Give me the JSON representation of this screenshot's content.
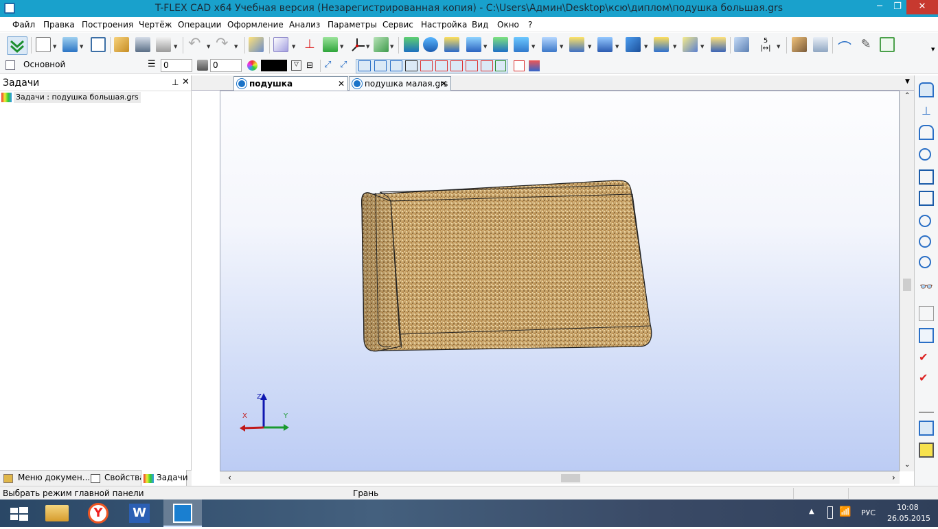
{
  "window": {
    "title": "T-FLEX CAD x64 Учебная версия (Незарегистрированная копия) - C:\\Users\\Админ\\Desktop\\ксю\\диплом\\подушка большая.grs"
  },
  "menu": [
    "Файл",
    "Правка",
    "Построения",
    "Чертёж",
    "Операции",
    "Оформление",
    "Анализ",
    "Параметры",
    "Сервис",
    "Настройка",
    "Вид",
    "Окно",
    "?"
  ],
  "toolbar2": {
    "layer_label": "Основной",
    "line_width_value": "0",
    "priority_value": "0"
  },
  "left_panel": {
    "title": "Задачи",
    "tree_item": "Задачи : подушка большая.grs",
    "bottom_tabs": [
      "Меню докумен...",
      "Свойства",
      "Задачи"
    ]
  },
  "doc_tabs": [
    "подушка большая.grs",
    "подушка малая.grs"
  ],
  "axes": {
    "x": "X",
    "y": "Y",
    "z": "Z"
  },
  "status": {
    "left": "Выбрать режим главной панели",
    "center": "Грань"
  },
  "taskbar": {
    "lang": "РУС",
    "time": "10:08",
    "date": "26.05.2015"
  },
  "colors": {
    "title_bar": "#19a1cc",
    "pillow": "#c9a56b",
    "accent": "#0c6aa8"
  },
  "icons": {
    "toolbar": [
      "check-icon",
      "new-document-icon",
      "new-3d-icon",
      "window-icon",
      "open-icon",
      "save-icon",
      "print-icon",
      "undo-icon",
      "redo-icon",
      "pen-icon",
      "sketch-icon",
      "line-icon",
      "profile-icon",
      "axes-icon",
      "workplane-icon",
      "extrude-icon",
      "rotate-icon",
      "shell-icon",
      "loft-icon",
      "sweep-icon",
      "fillet-icon",
      "pattern-icon",
      "boolean-icon",
      "solid-icon",
      "spline-icon",
      "surface-icon",
      "thicken-icon",
      "view-icon",
      "dimension-icon",
      "tools-icon",
      "calculator-icon",
      "clip-icon",
      "snap-icon",
      "copy-icon"
    ]
  }
}
